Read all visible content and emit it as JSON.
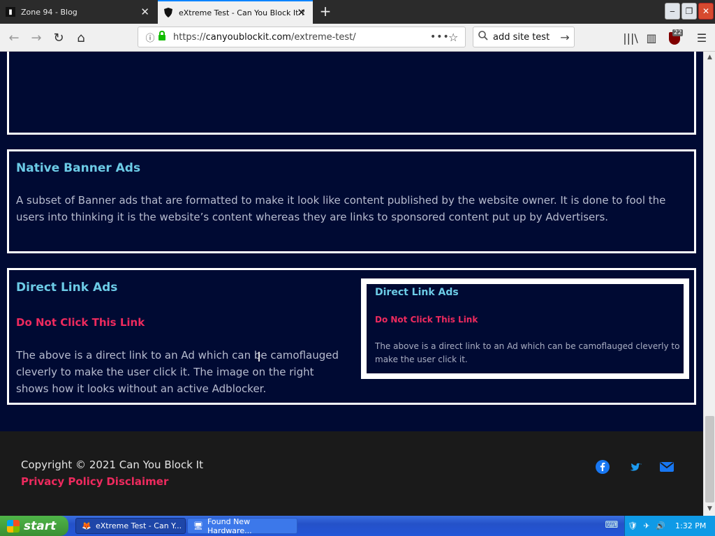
{
  "browser": {
    "tabs": [
      {
        "title": "Zone 94 - Blog",
        "icon": "zone94-favicon"
      },
      {
        "title": "eXtreme Test - Can You Block It ?",
        "icon": "shield-favicon"
      }
    ],
    "new_tab_label": "+",
    "close_label": "✕",
    "window_controls": {
      "minimize": "‒",
      "restore": "❐",
      "close": "✕"
    },
    "nav_icons": {
      "back": "←",
      "forward": "→",
      "reload": "↻",
      "home": "⌂"
    },
    "url": {
      "scheme": "https://",
      "host": "canyoublockit.com",
      "path": "/extreme-test/"
    },
    "url_glyphs": {
      "info": "ⓘ",
      "lock": "🔒",
      "more": "•••",
      "bookmark": "☆"
    },
    "search": {
      "value": "add site test",
      "mag": "🔍",
      "go": "→"
    },
    "toolbar_glyphs": {
      "library": "|||\\",
      "sidebar": "▥",
      "menu": "☰"
    },
    "ublock_badge": "22"
  },
  "page": {
    "native": {
      "heading": "Native Banner Ads",
      "text": "A subset of Banner ads that are formatted to make it look like content published by the website owner. It is done to fool the users into thinking it is the website’s content whereas they are links to sponsored content put up by Advertisers."
    },
    "direct": {
      "heading": "Direct Link Ads",
      "link": "Do Not Click This Link",
      "text": "The above is a direct link to an Ad which can be camoflauged cleverly to make the user click it. The image on the right shows how it looks without an active Adblocker.",
      "inset": {
        "heading": "Direct Link Ads",
        "link": "Do Not Click This Link",
        "text": "The above is a direct link to an Ad which can be camoflauged cleverly to make the user click it."
      }
    },
    "footer": {
      "copyright": "Copyright © 2021 Can You Block It",
      "links": [
        "Privacy Policy",
        "Disclaimer"
      ],
      "social_glyphs": {
        "facebook": "f",
        "twitter": "🐦",
        "email": "✉"
      }
    }
  },
  "scrollbar_glyphs": {
    "up": "▲",
    "down": "▼"
  },
  "taskbar": {
    "start_label": "start",
    "items": [
      {
        "label": "eXtreme Test - Can Y...",
        "icon": "firefox-icon",
        "glyph": "🦊"
      },
      {
        "label": "Found New Hardware...",
        "icon": "hardware-icon",
        "glyph": "🖥"
      }
    ],
    "kbd_glyph": "⌨",
    "tray_glyphs": [
      "🛡",
      "✈",
      "🔊"
    ],
    "clock": "1:32 PM"
  },
  "colors": {
    "page_bg": "#000a33",
    "heading": "#6ccbe6",
    "link_red": "#ee2a5e",
    "footer_bg": "#1a1a1a"
  }
}
